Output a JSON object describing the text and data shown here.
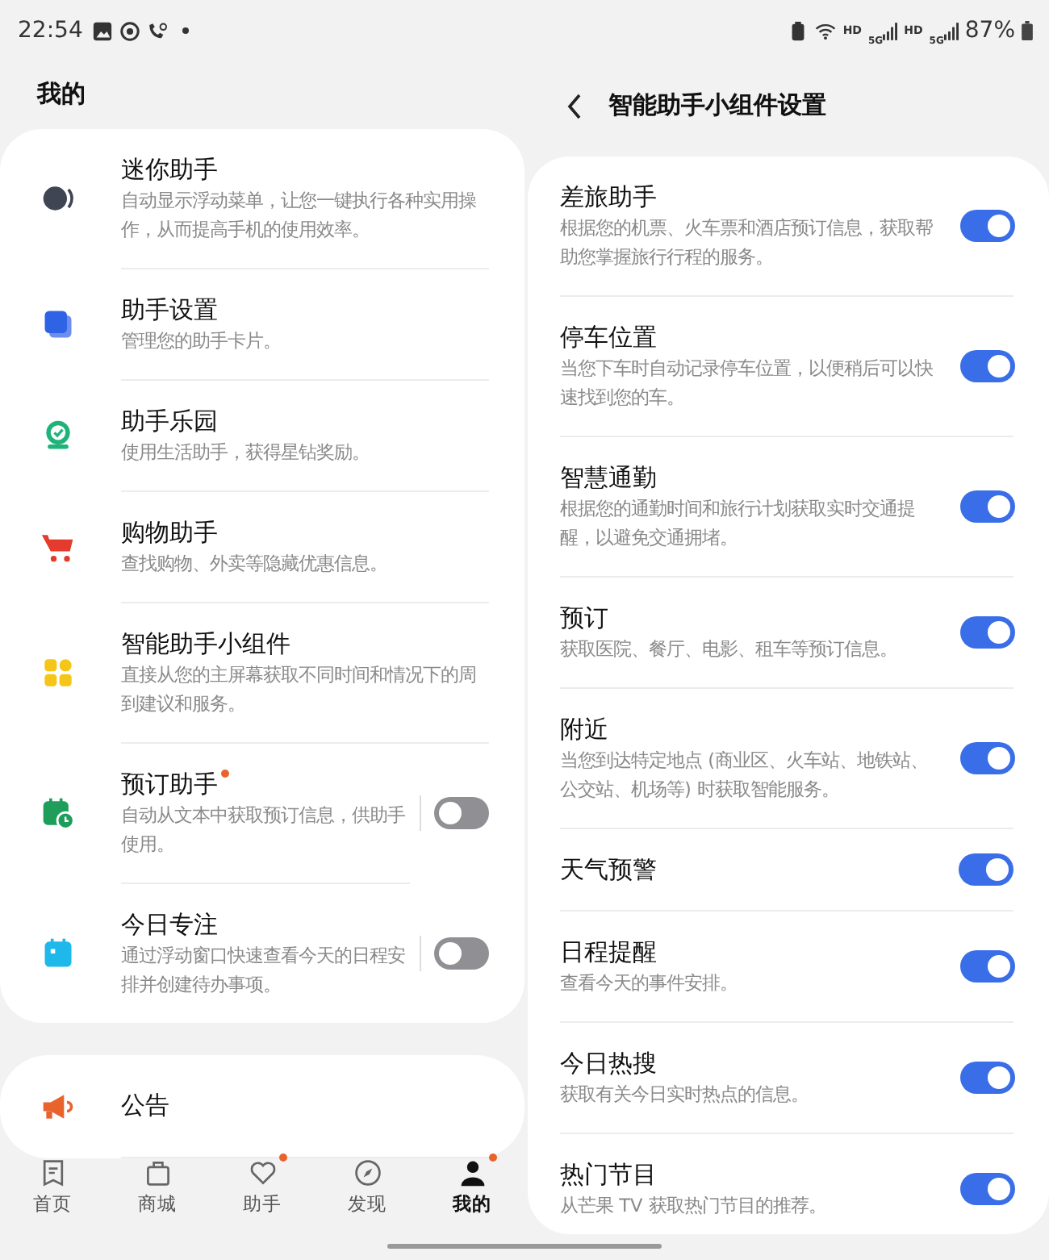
{
  "status_bar": {
    "time": "22:54",
    "networks": [
      {
        "hd": "HD",
        "gen": "5G"
      },
      {
        "hd": "HD",
        "gen": "5G"
      }
    ],
    "battery": "87%"
  },
  "left": {
    "title": "我的",
    "items": [
      {
        "kind": "link",
        "title": "迷你助手",
        "desc": "自动显示浮动菜单，让您一键执行各种实用操作，从而提高手机的使用效率。",
        "new": false
      },
      {
        "kind": "link",
        "title": "助手设置",
        "desc": "管理您的助手卡片。",
        "new": false
      },
      {
        "kind": "link",
        "title": "助手乐园",
        "desc": "使用生活助手，获得星钻奖励。",
        "new": false
      },
      {
        "kind": "link",
        "title": "购物助手",
        "desc": "查找购物、外卖等隐藏优惠信息。",
        "new": false
      },
      {
        "kind": "link",
        "title": "智能助手小组件",
        "desc": "直接从您的主屏幕获取不同时间和情况下的周到建议和服务。",
        "new": false
      },
      {
        "kind": "toggle",
        "title": "预订助手",
        "desc": "自动从文本中获取预订信息，供助手使用。",
        "new": true,
        "on": false
      },
      {
        "kind": "toggle",
        "title": "今日专注",
        "desc": "通过浮动窗口快速查看今天的日程安排并创建待办事项。",
        "new": false,
        "on": false
      }
    ],
    "notice": {
      "title": "公告"
    },
    "nav": [
      {
        "label": "首页",
        "selected": false,
        "badge": false
      },
      {
        "label": "商城",
        "selected": false,
        "badge": false
      },
      {
        "label": "助手",
        "selected": false,
        "badge": true
      },
      {
        "label": "发现",
        "selected": false,
        "badge": false
      },
      {
        "label": "我的",
        "selected": true,
        "badge": true
      }
    ]
  },
  "right": {
    "title": "智能助手小组件设置",
    "items": [
      {
        "title": "差旅助手",
        "desc": "根据您的机票、火车票和酒店预订信息，获取帮助您掌握旅行行程的服务。",
        "on": true
      },
      {
        "title": "停车位置",
        "desc": "当您下车时自动记录停车位置，以便稍后可以快速找到您的车。",
        "on": true
      },
      {
        "title": "智慧通勤",
        "desc": "根据您的通勤时间和旅行计划获取实时交通提醒，以避免交通拥堵。",
        "on": true
      },
      {
        "title": "预订",
        "desc": "获取医院、餐厅、电影、租车等预订信息。",
        "on": true
      },
      {
        "title": "附近",
        "desc": "当您到达特定地点 (商业区、火车站、地铁站、公交站、机场等) 时获取智能服务。",
        "on": true
      },
      {
        "title": "天气预警",
        "on": true
      },
      {
        "title": "日程提醒",
        "desc": "查看今天的事件安排。",
        "on": true
      },
      {
        "title": "今日热搜",
        "desc": "获取有关今日实时热点的信息。",
        "on": true
      },
      {
        "title": "热门节目",
        "desc": "从芒果 TV 获取热门节目的推荐。",
        "on": true
      }
    ]
  }
}
